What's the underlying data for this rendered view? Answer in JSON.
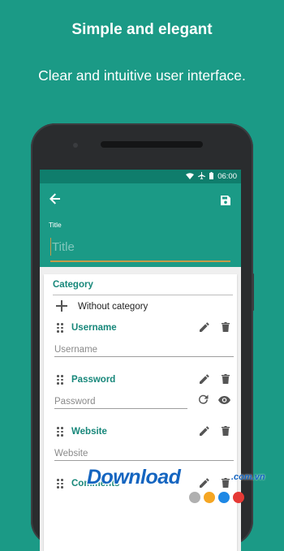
{
  "promo": {
    "headline": "Simple and elegant",
    "subline": "Clear and intuitive user interface."
  },
  "status_bar": {
    "time": "06:00",
    "icons": [
      "wifi-icon",
      "airplane-icon",
      "battery-icon"
    ]
  },
  "app_bar": {
    "back_icon": "arrow-back-icon",
    "save_icon": "save-icon",
    "title_label": "Title",
    "title_placeholder": "Title"
  },
  "form": {
    "category_label": "Category",
    "category_add_icon": "plus-icon",
    "category_value": "Without category",
    "fields": [
      {
        "name": "Username",
        "placeholder": "Username",
        "icons": [
          "drag-handle-icon",
          "edit-icon",
          "delete-icon"
        ]
      },
      {
        "name": "Password",
        "placeholder": "Password",
        "icons": [
          "drag-handle-icon",
          "edit-icon",
          "delete-icon",
          "refresh-icon",
          "visibility-icon"
        ]
      },
      {
        "name": "Website",
        "placeholder": "Website",
        "icons": [
          "drag-handle-icon",
          "edit-icon",
          "delete-icon"
        ]
      },
      {
        "name": "Comments",
        "placeholder": "",
        "icons": [
          "drag-handle-icon",
          "edit-icon",
          "delete-icon"
        ]
      }
    ]
  },
  "watermark": {
    "text": "Download",
    "tld": ".com.vn",
    "dot_colors": [
      "#ffffff",
      "#b0b0b0",
      "#f5a623",
      "#1e88e5",
      "#e53935"
    ]
  },
  "colors": {
    "primary": "#1b9a86",
    "primary_dark": "#0f7d6c",
    "accent_underline": "#c69a48",
    "field_label": "#17877a"
  }
}
